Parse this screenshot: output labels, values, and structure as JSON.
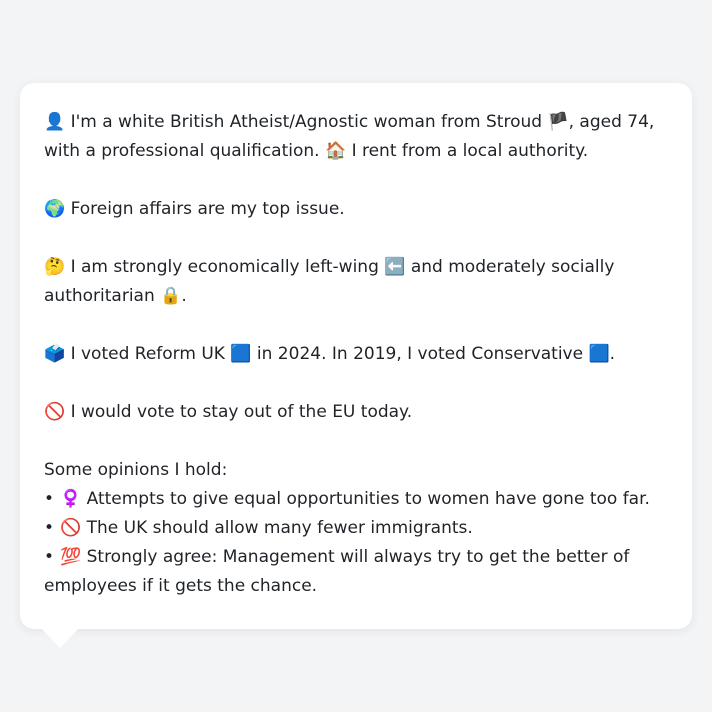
{
  "profile": {
    "identity": {
      "icon": "👤",
      "text_before": "I'm a white British Atheist/Agnostic woman from Stroud",
      "flag": "🏴",
      "text_mid": ", aged 74, with a professional qualification.",
      "house": "🏠",
      "text_after": "I rent from a local authority."
    },
    "top_issue": {
      "icon": "🌍",
      "text": "Foreign affairs are my top issue."
    },
    "stance": {
      "icon": "🤔",
      "text_before": "I am strongly economically left-wing",
      "arrow": "⬅️",
      "text_mid": "and moderately socially authoritarian",
      "lock": "🔒",
      "text_after": "."
    },
    "votes": {
      "icon": "🗳️",
      "text_before": "I voted Reform UK",
      "square1": "🟦",
      "text_mid": "in 2024. In 2019, I voted Conservative",
      "square2": "🟦",
      "text_after": "."
    },
    "eu": {
      "icon": "🚫",
      "text": "I would vote to stay out of the EU today."
    },
    "opinions": {
      "heading": "Some opinions I hold:",
      "items": [
        {
          "bullet": "•",
          "icon": "♀️",
          "text": "Attempts to give equal opportunities to women have gone too far."
        },
        {
          "bullet": "•",
          "icon": "🚫",
          "text": "The UK should allow many fewer immigrants."
        },
        {
          "bullet": "•",
          "icon": "💯",
          "text": "Strongly agree: Management will always try to get the better of employees if it gets the chance."
        }
      ]
    }
  }
}
